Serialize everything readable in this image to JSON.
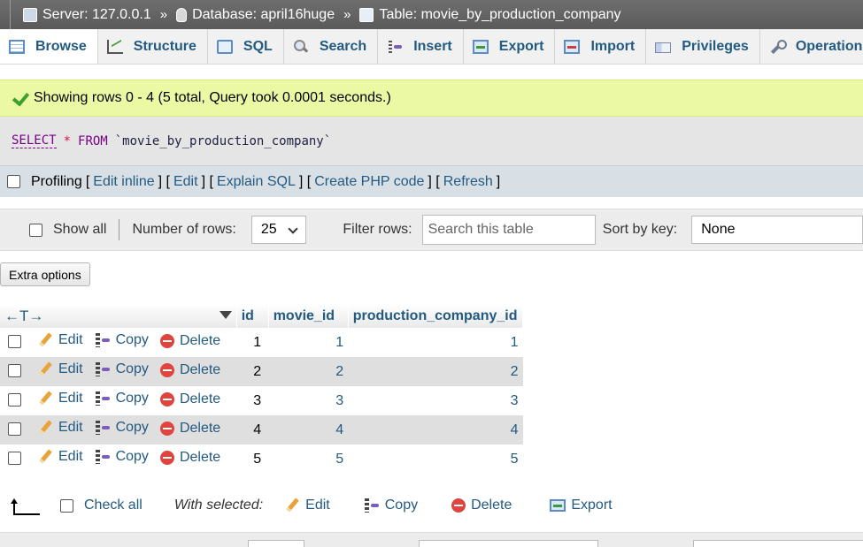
{
  "breadcrumb": {
    "server": "Server: 127.0.0.1",
    "database": "Database: april16huge",
    "table": "Table: movie_by_production_company",
    "separator": "»"
  },
  "tabs": [
    {
      "label": "Browse",
      "icon": "browse-icon",
      "active": true
    },
    {
      "label": "Structure",
      "icon": "structure-icon"
    },
    {
      "label": "SQL",
      "icon": "sql-icon"
    },
    {
      "label": "Search",
      "icon": "search-icon"
    },
    {
      "label": "Insert",
      "icon": "insert-icon"
    },
    {
      "label": "Export",
      "icon": "export-icon"
    },
    {
      "label": "Import",
      "icon": "import-icon"
    },
    {
      "label": "Privileges",
      "icon": "privileges-icon"
    },
    {
      "label": "Operations",
      "icon": "wrench-icon"
    }
  ],
  "success": {
    "message": "Showing rows 0 - 4 (5 total, Query took 0.0001 seconds.)"
  },
  "query": {
    "select": "SELECT",
    "star": "*",
    "from": "FROM",
    "table": "`movie_by_production_company`"
  },
  "profiling": {
    "label": "Profiling",
    "links": [
      "Edit inline",
      "Edit",
      "Explain SQL",
      "Create PHP code",
      "Refresh"
    ]
  },
  "navigation": {
    "show_all": "Show all",
    "rows_label": "Number of rows:",
    "rows_value": "25",
    "filter_label": "Filter rows:",
    "filter_placeholder": "Search this table",
    "sort_label": "Sort by key:",
    "sort_value": "None"
  },
  "extra_options": "Extra options",
  "table": {
    "arrows": "←T→",
    "columns": [
      "id",
      "movie_id",
      "production_company_id"
    ],
    "actions": {
      "edit": "Edit",
      "copy": "Copy",
      "delete": "Delete"
    },
    "rows": [
      [
        "1",
        "1",
        "1"
      ],
      [
        "2",
        "2",
        "2"
      ],
      [
        "3",
        "3",
        "3"
      ],
      [
        "4",
        "4",
        "4"
      ],
      [
        "5",
        "5",
        "5"
      ]
    ]
  },
  "bulk": {
    "check_all": "Check all",
    "with_selected": "With selected:",
    "edit": "Edit",
    "copy": "Copy",
    "delete": "Delete",
    "export": "Export"
  },
  "colors": {
    "link": "#235a81",
    "success_bg": "#ebf8a4",
    "row_alt": "#dfdfdf",
    "delete": "#e0443e"
  }
}
